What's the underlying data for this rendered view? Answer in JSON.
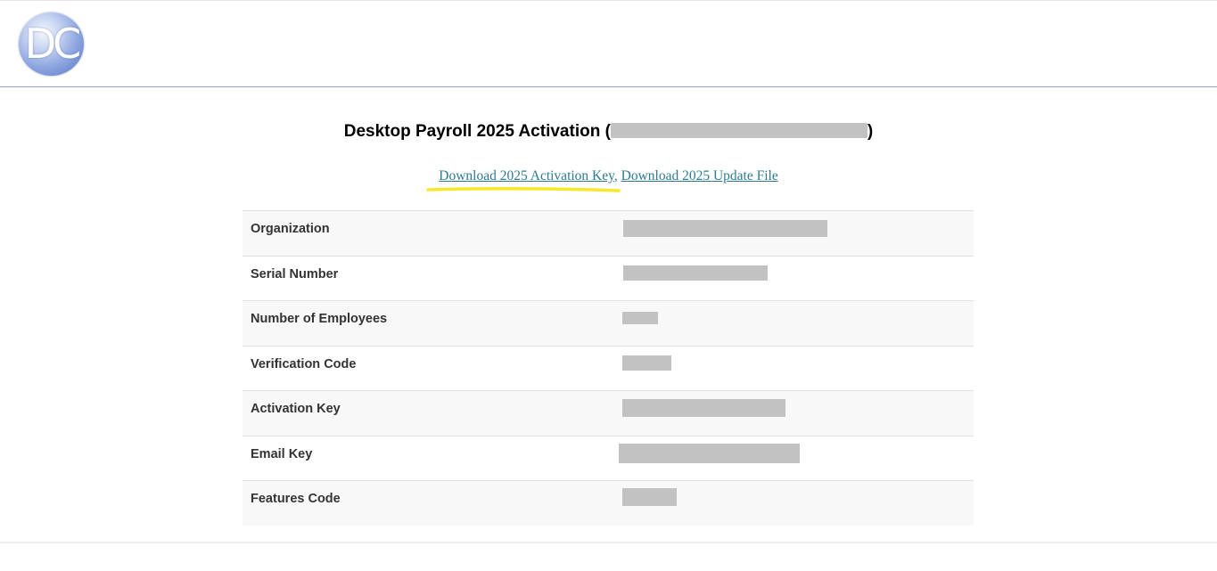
{
  "header": {
    "logo_text": "DC"
  },
  "title": {
    "prefix": "Desktop Payroll 2025 Activation (",
    "suffix": ")"
  },
  "links": {
    "activation_key": "Download 2025 Activation Key",
    "separator": ",",
    "update_file": "Download 2025 Update File"
  },
  "colors": {
    "link": "#2d7b91",
    "highlight": "#f7e82a",
    "header_rule": "#8aa8d8",
    "redaction": "#c2c2c2"
  },
  "table": {
    "rows": [
      {
        "label": "Organization"
      },
      {
        "label": "Serial Number"
      },
      {
        "label": "Number of Employees"
      },
      {
        "label": "Verification Code"
      },
      {
        "label": "Activation Key"
      },
      {
        "label": "Email Key"
      },
      {
        "label": "Features Code"
      }
    ]
  }
}
